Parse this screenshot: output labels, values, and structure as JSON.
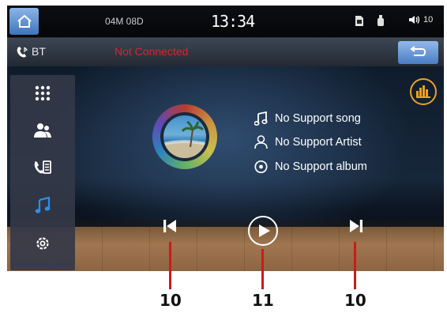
{
  "status_bar": {
    "date": "04M 08D",
    "time": "13:34",
    "volume": "10"
  },
  "bt_bar": {
    "label": "BT",
    "status": "Not Connected",
    "status_color": "#d9262a"
  },
  "sidebar": {
    "items": [
      {
        "icon": "apps-grid-icon"
      },
      {
        "icon": "contacts-icon"
      },
      {
        "icon": "phone-book-icon"
      },
      {
        "icon": "music-note-icon",
        "active": true
      },
      {
        "icon": "settings-icon"
      }
    ],
    "active_color": "#2f8de8"
  },
  "track": {
    "song": "No Support song",
    "artist": "No Support Artist",
    "album": "No Support album"
  },
  "controls": {
    "prev": "previous-track-icon",
    "play": "play-icon",
    "next": "next-track-icon"
  },
  "callouts": {
    "prev": "10",
    "play": "11",
    "next": "10"
  },
  "colors": {
    "accent_button": "#4a7dc3",
    "eq_color": "#f0a020"
  }
}
